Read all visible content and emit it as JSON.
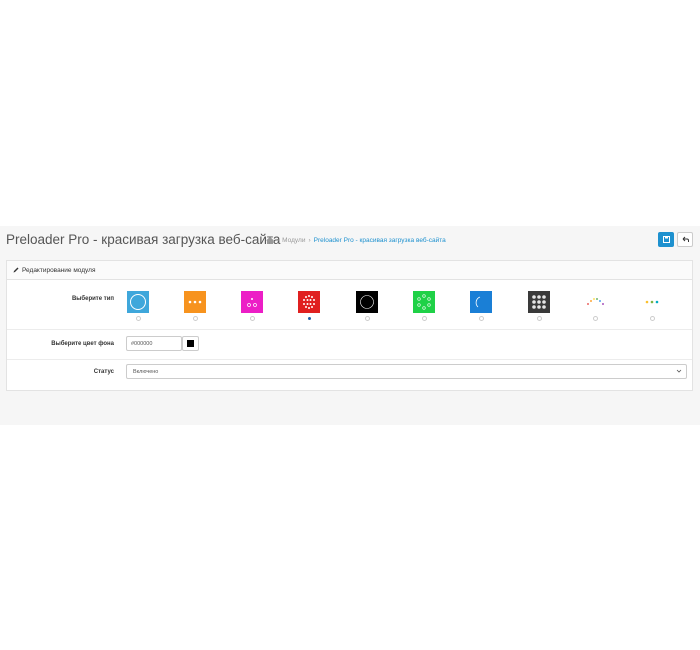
{
  "header": {
    "title": "Preloader Pro - красивая загрузка веб-сайта",
    "breadcrumb": {
      "modules": "Модули",
      "current": "Preloader Pro - красивая загрузка веб-сайта"
    },
    "save_icon": "save-icon",
    "back_icon": "back-arrow-icon"
  },
  "panel": {
    "heading": "Редактирование модуля",
    "type_label": "Выберите тип",
    "loaders": [
      {
        "name": "ring-loader",
        "bg": "#3fa7db",
        "selected": false
      },
      {
        "name": "three-dots-loader",
        "bg": "#f7931e",
        "selected": false
      },
      {
        "name": "bubbles-loader",
        "bg": "#ec1ec6",
        "selected": false
      },
      {
        "name": "dot-grid-loader",
        "bg": "#e02020",
        "selected": true
      },
      {
        "name": "circle-loader",
        "bg": "#000000",
        "selected": false
      },
      {
        "name": "orbit-loader",
        "bg": "#1fd147",
        "selected": false
      },
      {
        "name": "arc-loader",
        "bg": "#1a7fd6",
        "selected": false
      },
      {
        "name": "grid-3x3-loader",
        "bg": "#3a3a3a",
        "selected": false
      },
      {
        "name": "wave-dots-loader",
        "bg": "#ffffff",
        "selected": false
      },
      {
        "name": "color-dots-loader",
        "bg": "#ffffff",
        "selected": false
      }
    ],
    "color_label": "Выберите цвет фона",
    "color_value": "#000000",
    "status_label": "Статус",
    "status_value": "Включено"
  }
}
